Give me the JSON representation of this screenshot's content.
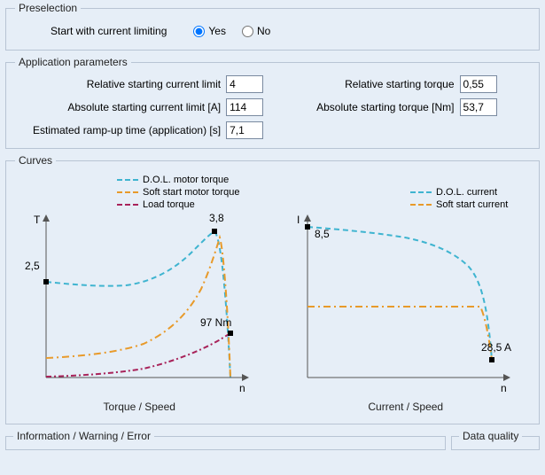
{
  "preselection": {
    "legend": "Preselection",
    "label": "Start with current limiting",
    "yes": "Yes",
    "no": "No",
    "value": "yes"
  },
  "params": {
    "legend": "Application parameters",
    "rel_current_limit_label": "Relative starting current limit",
    "rel_current_limit_value": "4",
    "abs_current_limit_label": "Absolute starting current limit  [A]",
    "abs_current_limit_value": "114",
    "ramp_time_label": "Estimated ramp-up time (application)  [s]",
    "ramp_time_value": "7,1",
    "rel_torque_label": "Relative starting torque",
    "rel_torque_value": "0,55",
    "abs_torque_label": "Absolute starting torque  [Nm]",
    "abs_torque_value": "53,7"
  },
  "curves": {
    "legend": "Curves",
    "torque_caption": "Torque / Speed",
    "current_caption": "Current / Speed",
    "legend_dol_torque": "D.O.L. motor torque",
    "legend_soft_torque": "Soft start motor torque",
    "legend_load_torque": "Load torque",
    "legend_dol_current": "D.O.L. current",
    "legend_soft_current": "Soft start current",
    "axis_T": "T",
    "axis_I": "I",
    "axis_n": "n",
    "marker_torque_start": "2,5",
    "marker_torque_peak": "3,8",
    "marker_torque_end": "97 Nm",
    "marker_current_start": "8,5",
    "marker_current_end": "28,5 A"
  },
  "bottom": {
    "info_legend": "Information / Warning / Error",
    "quality_legend": "Data quality"
  },
  "chart_data": [
    {
      "type": "line",
      "title": "Torque / Speed",
      "xlabel": "n",
      "ylabel": "T",
      "series": [
        {
          "name": "D.O.L. motor torque",
          "color": "#3FB4D0",
          "x": [
            0,
            0.1,
            0.2,
            0.3,
            0.4,
            0.5,
            0.6,
            0.7,
            0.8,
            0.85,
            0.9,
            0.95,
            1.0
          ],
          "y": [
            2.5,
            2.45,
            2.4,
            2.4,
            2.45,
            2.55,
            2.8,
            3.15,
            3.5,
            3.7,
            3.8,
            3.2,
            0
          ]
        },
        {
          "name": "Soft start motor torque",
          "color": "#E89A2A",
          "x": [
            0,
            0.1,
            0.2,
            0.3,
            0.4,
            0.5,
            0.6,
            0.7,
            0.8,
            0.85,
            0.9,
            0.95,
            1.0
          ],
          "y": [
            0.55,
            0.56,
            0.58,
            0.62,
            0.7,
            0.82,
            1.05,
            1.45,
            2.25,
            2.9,
            3.5,
            3.0,
            0
          ]
        },
        {
          "name": "Load torque",
          "color": "#A8235A",
          "x": [
            0,
            0.1,
            0.2,
            0.3,
            0.4,
            0.5,
            0.6,
            0.7,
            0.8,
            0.9,
            1.0
          ],
          "y": [
            0.02,
            0.03,
            0.05,
            0.09,
            0.14,
            0.22,
            0.33,
            0.47,
            0.65,
            0.85,
            1.0
          ]
        }
      ],
      "annotations": [
        {
          "text": "2,5",
          "x": 0,
          "y": 2.5
        },
        {
          "text": "3,8",
          "x": 0.9,
          "y": 3.8
        },
        {
          "text": "97 Nm",
          "x": 1.0,
          "y": 1.0
        }
      ]
    },
    {
      "type": "line",
      "title": "Current / Speed",
      "xlabel": "n",
      "ylabel": "I",
      "series": [
        {
          "name": "D.O.L. current",
          "color": "#3FB4D0",
          "x": [
            0,
            0.1,
            0.2,
            0.3,
            0.4,
            0.5,
            0.6,
            0.7,
            0.8,
            0.9,
            0.95,
            1.0
          ],
          "y": [
            8.5,
            8.4,
            8.3,
            8.15,
            8.0,
            7.8,
            7.5,
            7.1,
            6.4,
            5.2,
            3.8,
            1.0
          ]
        },
        {
          "name": "Soft start current",
          "color": "#E89A2A",
          "x": [
            0,
            0.1,
            0.2,
            0.3,
            0.4,
            0.5,
            0.6,
            0.7,
            0.8,
            0.9,
            0.95,
            1.0
          ],
          "y": [
            4.0,
            4.0,
            4.0,
            4.0,
            4.0,
            4.0,
            4.0,
            4.0,
            4.0,
            4.0,
            3.6,
            1.0
          ]
        }
      ],
      "annotations": [
        {
          "text": "8,5",
          "x": 0,
          "y": 8.5
        },
        {
          "text": "28,5 A",
          "x": 1.0,
          "y": 1.0
        }
      ]
    }
  ]
}
